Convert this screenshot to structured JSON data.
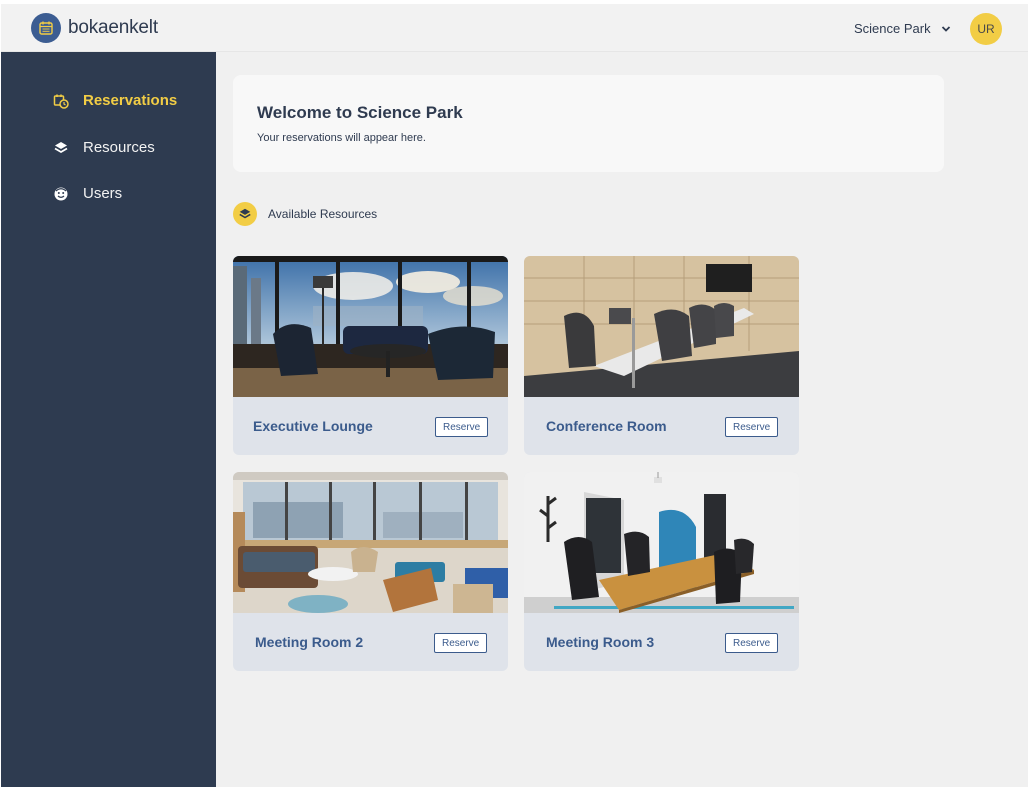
{
  "header": {
    "brand": "bokaenkelt",
    "site_selector": "Science Park",
    "avatar_initials": "UR"
  },
  "sidebar": {
    "items": [
      {
        "label": "Reservations",
        "icon": "calendar-clock-icon",
        "active": true
      },
      {
        "label": "Resources",
        "icon": "layers-icon",
        "active": false
      },
      {
        "label": "Users",
        "icon": "user-face-icon",
        "active": false
      }
    ]
  },
  "welcome": {
    "title": "Welcome to Science Park",
    "subtitle": "Your reservations will appear here."
  },
  "resources_section": {
    "label": "Available Resources",
    "reserve_label": "Reserve",
    "cards": [
      {
        "name": "Executive Lounge",
        "image": "lounge-photo"
      },
      {
        "name": "Conference Room",
        "image": "conference-room-photo"
      },
      {
        "name": "Meeting Room 2",
        "image": "meeting-room-2-photo"
      },
      {
        "name": "Meeting Room 3",
        "image": "meeting-room-3-photo"
      }
    ]
  },
  "colors": {
    "sidebar": "#2e3b50",
    "accent": "#f2cd45",
    "primary": "#3b5b8c"
  }
}
